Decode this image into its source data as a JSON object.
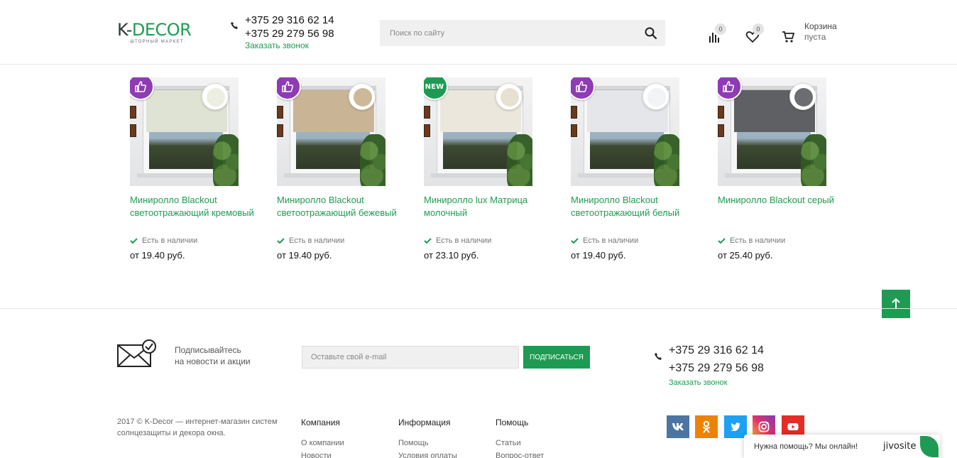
{
  "header": {
    "logo_main_k": "K-",
    "logo_main_d": "DECOR",
    "logo_sub": "·ШТОРНЫЙ МАРКЕТ·",
    "phone1": "+375 29 316 62 14",
    "phone2": "+375 29 279 56 98",
    "callback": "Заказать звонок",
    "search_placeholder": "Поиск по сайту",
    "compare_count": "0",
    "wishlist_count": "0",
    "cart_line1": "Корзина",
    "cart_line2": "пуста"
  },
  "products": [
    {
      "name": "Миниролло Blackout светоотражающий кремовый",
      "stock": "Есть в наличии",
      "price": "от 19.40 руб.",
      "sticker": "like",
      "color": "#dfe3d3",
      "swatch": "#ecefe0"
    },
    {
      "name": "Миниролло Blackout светоотражающий бежевый",
      "stock": "Есть в наличии",
      "price": "от 19.40 руб.",
      "sticker": "like",
      "color": "#c9b596",
      "swatch": "#cdb99a"
    },
    {
      "name": "Миниролло lux Матрица молочный",
      "stock": "Есть в наличии",
      "price": "от 23.10 руб.",
      "sticker": "new",
      "sticker_label": "NEW",
      "color": "#ece7dc",
      "swatch": "#e8e1d2"
    },
    {
      "name": "Миниролло Blackout светоотражающий белый",
      "stock": "Есть в наличии",
      "price": "от 19.40 руб.",
      "sticker": "like",
      "color": "#e4e6ea",
      "swatch": "#f2f3f5"
    },
    {
      "name": "Миниролло Blackout серый",
      "stock": "Есть в наличии",
      "price": "от 25.40 руб.",
      "sticker": "like",
      "color": "#5f6063",
      "swatch": "#6c6d70"
    }
  ],
  "subscribe": {
    "line1": "Подписывайтесь",
    "line2": "на новости и акции",
    "email_placeholder": "Оставьте свой e-mail",
    "button": "Подписаться"
  },
  "footer": {
    "phone1": "+375 29 316 62 14",
    "phone2": "+375 29 279 56 98",
    "callback": "Заказать звонок",
    "copyright": "2017 © K-Decor — интернет-магазин систем солнцезащиты и декора окна.",
    "columns": [
      {
        "title": "Компания",
        "links": [
          "О компании",
          "Новости"
        ]
      },
      {
        "title": "Информация",
        "links": [
          "Помощь",
          "Условия оплаты"
        ]
      },
      {
        "title": "Помощь",
        "links": [
          "Статьи",
          "Вопрос-ответ"
        ]
      }
    ],
    "social": [
      {
        "icon": "vk-icon",
        "color": "#4c75a3"
      },
      {
        "icon": "odnoklassniki-icon",
        "color": "#ee8208"
      },
      {
        "icon": "twitter-icon",
        "color": "#1da1f2"
      },
      {
        "icon": "instagram-icon",
        "color": "#c13584"
      },
      {
        "icon": "youtube-icon",
        "color": "#e52d27"
      }
    ]
  },
  "chat": {
    "text": "Нужна помощь? Мы онлайн!",
    "brand": "jivosite"
  },
  "colors": {
    "accent": "#1e9b52",
    "sticker_like": "#8e3bb4"
  }
}
